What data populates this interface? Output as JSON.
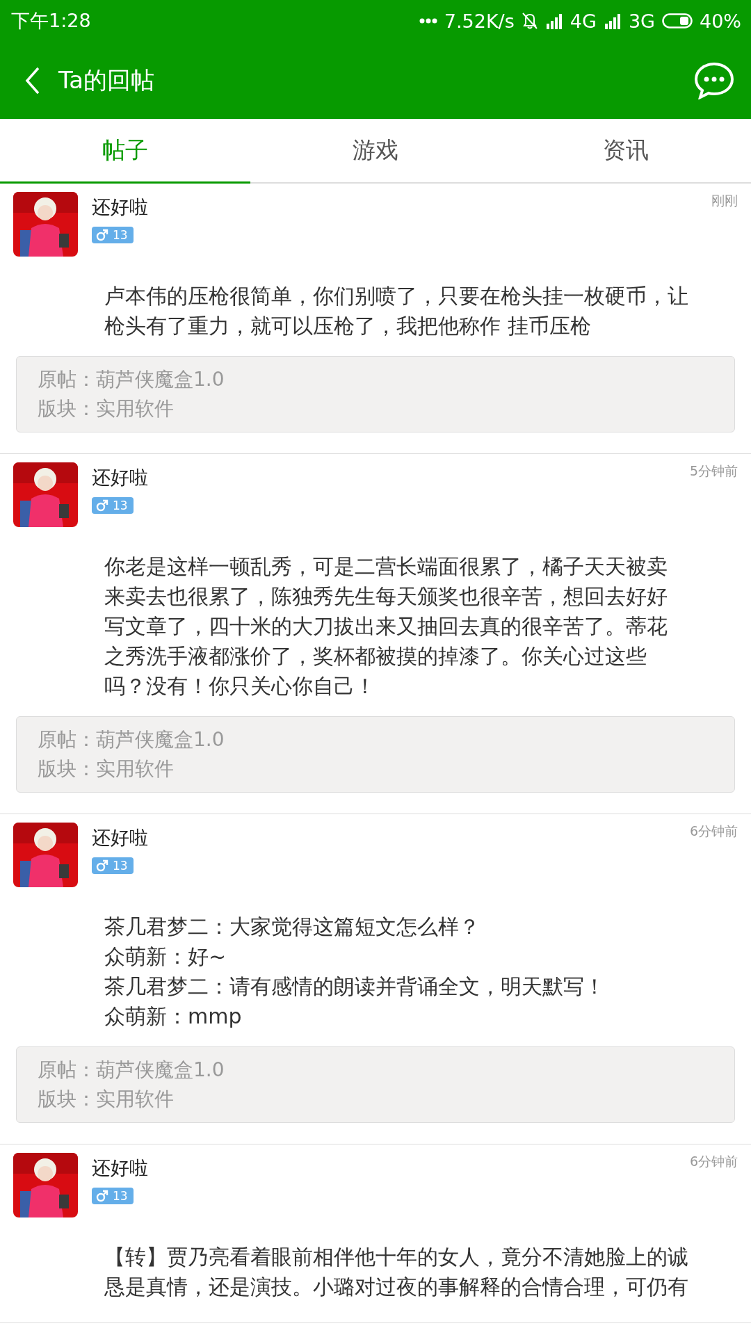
{
  "status_bar": {
    "time": "下午1:28",
    "speed": "7.52K/s",
    "network_1": "4G",
    "network_2": "3G",
    "battery": "40%"
  },
  "header": {
    "title": "Ta的回帖"
  },
  "tabs": [
    {
      "label": "帖子",
      "selected": true
    },
    {
      "label": "游戏",
      "selected": false
    },
    {
      "label": "资讯",
      "selected": false
    }
  ],
  "posts": [
    {
      "author": "还好啦",
      "level": "13",
      "time": "刚刚",
      "body": [
        "卢本伟的压枪很简单，你们别喷了，只要在枪头挂一枚硬币，让",
        "枪头有了重力，就可以压枪了，我把他称作 挂币压枪"
      ],
      "source": "原帖：葫芦侠魔盒1.0",
      "board": "版块：实用软件"
    },
    {
      "author": "还好啦",
      "level": "13",
      "time": "5分钟前",
      "body": [
        "你老是这样一顿乱秀，可是二营长端面很累了，橘子天天被卖",
        "来卖去也很累了，陈独秀先生每天颁奖也很辛苦，想回去好好",
        "写文章了，四十米的大刀拔出来又抽回去真的很辛苦了。蒂花",
        "之秀洗手液都涨价了，奖杯都被摸的掉漆了。你关心过这些",
        "吗？没有！你只关心你自己！"
      ],
      "source": "原帖：葫芦侠魔盒1.0",
      "board": "版块：实用软件"
    },
    {
      "author": "还好啦",
      "level": "13",
      "time": "6分钟前",
      "body": [
        "茶几君梦二：大家觉得这篇短文怎么样？",
        "众萌新：好~",
        "茶几君梦二：请有感情的朗读并背诵全文，明天默写！",
        "众萌新：mmp"
      ],
      "source": "原帖：葫芦侠魔盒1.0",
      "board": "版块：实用软件"
    },
    {
      "author": "还好啦",
      "level": "13",
      "time": "6分钟前",
      "body": [
        "【转】贾乃亮看着眼前相伴他十年的女人，竟分不清她脸上的诚",
        "恳是真情，还是演技。小璐对过夜的事解释的合情合理，可仍有"
      ]
    }
  ]
}
